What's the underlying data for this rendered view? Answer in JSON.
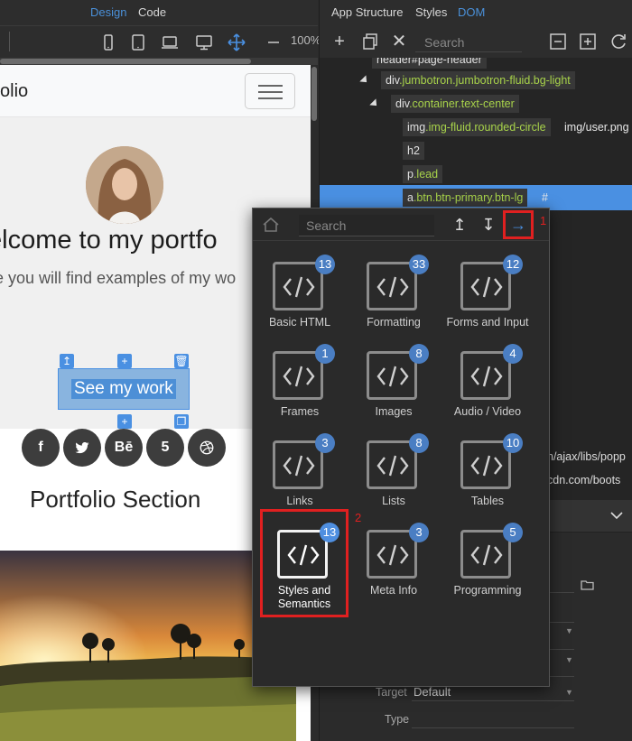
{
  "left_tabs": {
    "design": "Design",
    "code": "Code"
  },
  "zoom": "100%",
  "site": {
    "brand": "olio",
    "heading": "elcome to my portfo",
    "lead": "re you will find examples of my wo",
    "cta": "See my work",
    "social_behance": "Bē",
    "social_html5": "5",
    "section_title": "Portfolio Section"
  },
  "right_tabs": {
    "app_structure": "App Structure",
    "styles": "Styles",
    "dom": "DOM"
  },
  "dom_search_placeholder": "Search",
  "dom_tree": {
    "header": "header#page-header",
    "div_jumbotron_tag": "div",
    "div_jumbotron_cls": ".jumbotron.jumbotron-fluid.bg-light",
    "div_container_tag": "div",
    "div_container_cls": ".container.text-center",
    "img_tag": "img",
    "img_cls": ".img-fluid.rounded-circle",
    "img_src": "img/user.png",
    "h2": "h2",
    "p_tag": "p",
    "p_cls": ".lead",
    "a_tag": "a",
    "a_cls": ".btn.btn-primary.btn-lg",
    "a_href": "#",
    "script1_tail": "n/ajax/libs/popp",
    "script2_tail": "cdn.com/boots"
  },
  "properties": {
    "target_label": "Target",
    "target_value": "Default",
    "type_label": "Type"
  },
  "popup": {
    "search_placeholder": "Search",
    "marker_1": "1",
    "marker_2": "2",
    "categories": [
      {
        "name": "Basic HTML",
        "count": "13"
      },
      {
        "name": "Formatting",
        "count": "33"
      },
      {
        "name": "Forms and Input",
        "count": "12"
      },
      {
        "name": "Frames",
        "count": "1"
      },
      {
        "name": "Images",
        "count": "8"
      },
      {
        "name": "Audio / Video",
        "count": "4"
      },
      {
        "name": "Links",
        "count": "3"
      },
      {
        "name": "Lists",
        "count": "8"
      },
      {
        "name": "Tables",
        "count": "10"
      },
      {
        "name": "Styles and Semantics",
        "count": "13"
      },
      {
        "name": "Meta Info",
        "count": "3"
      },
      {
        "name": "Programming",
        "count": "5"
      }
    ]
  }
}
